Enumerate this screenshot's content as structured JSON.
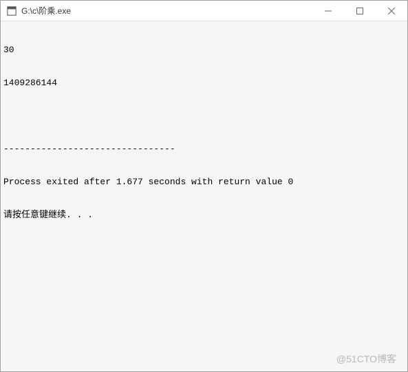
{
  "titlebar": {
    "title": "G:\\c\\阶乘.exe"
  },
  "console": {
    "line1": "30",
    "line2": "1409286144",
    "line3": "",
    "line4": "--------------------------------",
    "line5": "Process exited after 1.677 seconds with return value 0",
    "line6": "请按任意键继续. . ."
  },
  "watermark": "@51CTO博客"
}
